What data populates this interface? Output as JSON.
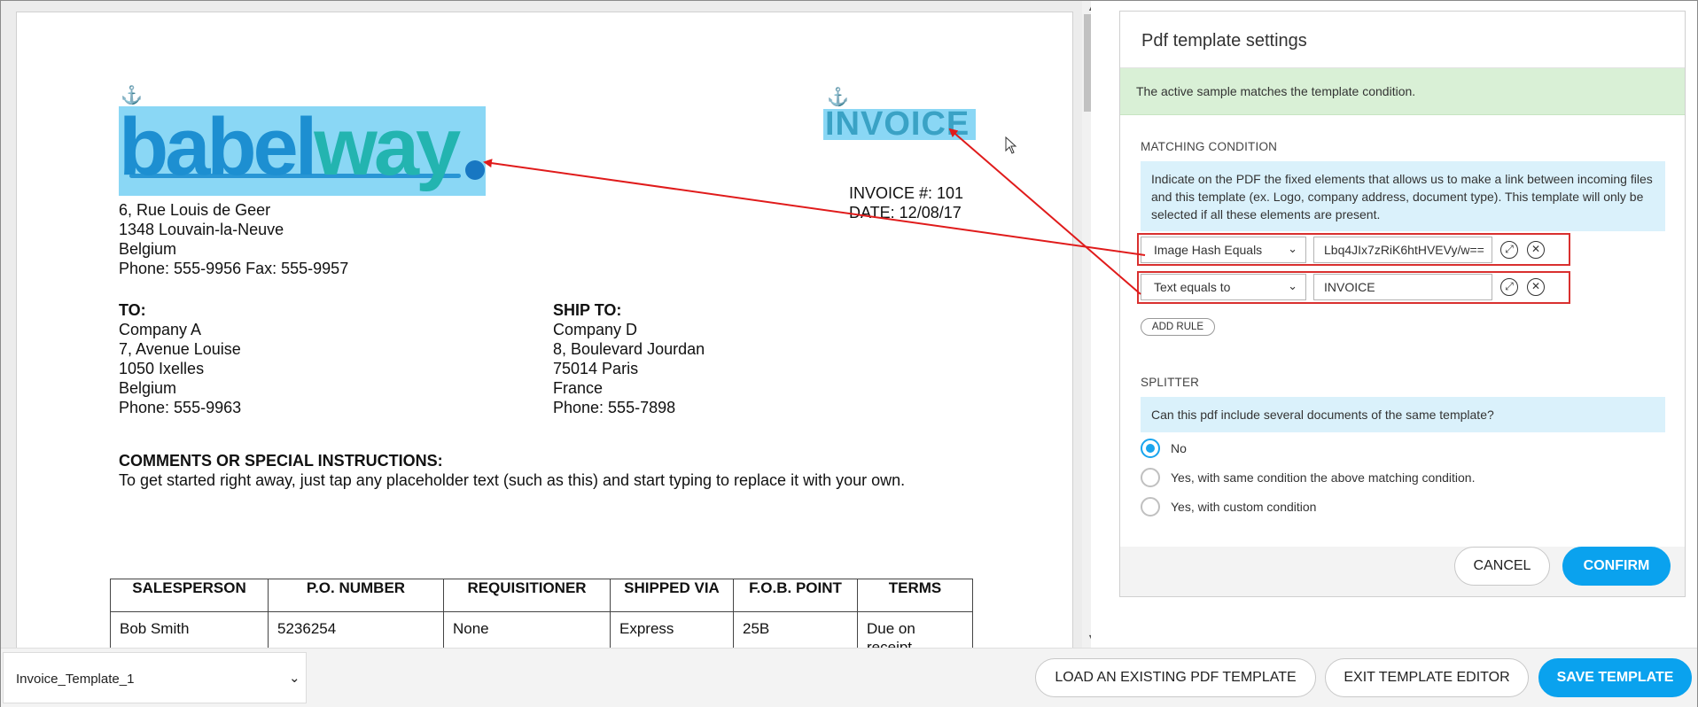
{
  "pdf": {
    "logo": {
      "part1": "babel",
      "part2": "way"
    },
    "address": [
      "6, Rue Louis de Geer",
      "1348 Louvain-la-Neuve",
      "Belgium",
      "Phone: 555-9956  Fax: 555-9957"
    ],
    "invoice_title": "INVOICE",
    "invoice_number": "INVOICE #:  101",
    "invoice_date": "DATE:  12/08/17",
    "to": {
      "heading": "TO:",
      "lines": [
        "Company A",
        "7, Avenue Louise",
        "1050 Ixelles",
        "Belgium",
        "Phone:  555-9963"
      ]
    },
    "ship_to": {
      "heading": "SHIP TO:",
      "lines": [
        "Company D",
        "8, Boulevard Jourdan",
        "75014 Paris",
        "France",
        "Phone:  555-7898"
      ]
    },
    "comments": {
      "heading": "COMMENTS OR SPECIAL INSTRUCTIONS:",
      "text": "To get started right away, just tap any placeholder text (such as this) and start typing to replace it with your own."
    },
    "table": {
      "headers": [
        "SALESPERSON",
        "P.O. NUMBER",
        "REQUISITIONER",
        "SHIPPED VIA",
        "F.O.B. POINT",
        "TERMS"
      ],
      "row": [
        "Bob Smith",
        "5236254",
        "None",
        "Express",
        "25B",
        "Due on receipt"
      ]
    }
  },
  "panel": {
    "title": "Pdf template settings",
    "success": "The active sample matches the template condition.",
    "matching_title": "MATCHING CONDITION",
    "matching_info": "Indicate on the PDF the fixed elements that allows us to make a link between incoming files and this template (ex. Logo, company address, document type). This template will only be selected if all these elements are present.",
    "rules": [
      {
        "type": "Image Hash Equals",
        "value": "Lbq4JIx7zRiK6htHVEVy/w=="
      },
      {
        "type": "Text equals to",
        "value": "INVOICE"
      }
    ],
    "add_rule": "ADD RULE",
    "splitter_title": "SPLITTER",
    "splitter_question": "Can this pdf include several documents of the same template?",
    "splitter_options": [
      {
        "label": "No",
        "selected": true
      },
      {
        "label": "Yes, with same condition the above matching condition.",
        "selected": false
      },
      {
        "label": "Yes, with custom condition",
        "selected": false
      }
    ],
    "cancel": "CANCEL",
    "confirm": "CONFIRM"
  },
  "bottom": {
    "template_name": "Invoice_Template_1",
    "load_button": "LOAD AN EXISTING PDF TEMPLATE",
    "exit_button": "EXIT TEMPLATE EDITOR",
    "save_button": "SAVE TEMPLATE"
  },
  "colors": {
    "accent": "#0aa2ee",
    "highlight": "#8ad7f5",
    "rule_border": "#d9302f",
    "success_bg": "#d9f0d6",
    "info_bg": "#daf1fb"
  }
}
